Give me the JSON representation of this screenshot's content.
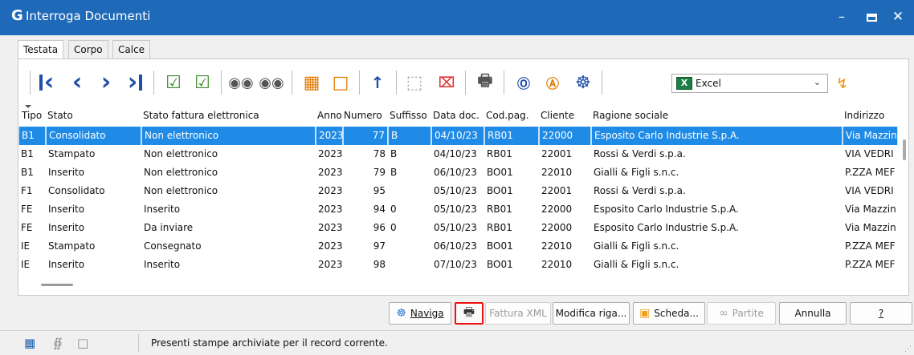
{
  "window": {
    "logo": "G",
    "title": "Interroga Documenti"
  },
  "tabs": [
    "Testata",
    "Corpo",
    "Calce"
  ],
  "toolbar": {
    "export_format": "Excel",
    "icons": [
      "first-icon",
      "prev-icon",
      "next-icon",
      "last-icon",
      "check-icon",
      "check-all-icon",
      "binoculars-icon",
      "binoculars-run-icon",
      "columns-icon",
      "tag-icon",
      "sort-az-icon",
      "select-icon",
      "deselect-icon",
      "print-icon",
      "l-icon",
      "a-icon",
      "ship-wheel-icon",
      "excel-icon",
      "bolt-icon"
    ]
  },
  "grid": {
    "headers": [
      "Tipo",
      "Stato",
      "Stato fattura elettronica",
      "Anno",
      "Numero",
      "Suffisso",
      "Data doc.",
      "Cod.pag.",
      "Cliente",
      "Ragione sociale",
      "Indirizzo"
    ],
    "rows": [
      {
        "tipo": "B1",
        "stato": "Consolidato",
        "fe": "Non elettronico",
        "anno": "2023",
        "numero": "77",
        "suffisso": "B",
        "data": "04/10/23",
        "codpag": "RB01",
        "cliente": "22000",
        "ragione": "Esposito Carlo Industrie S.p.A.",
        "indirizzo": "Via Mazzin"
      },
      {
        "tipo": "B1",
        "stato": "Stampato",
        "fe": "Non elettronico",
        "anno": "2023",
        "numero": "78",
        "suffisso": "B",
        "data": "04/10/23",
        "codpag": "RB01",
        "cliente": "22001",
        "ragione": "Rossi & Verdi s.p.a.",
        "indirizzo": "VIA VEDRI"
      },
      {
        "tipo": "B1",
        "stato": "Inserito",
        "fe": "Non elettronico",
        "anno": "2023",
        "numero": "79",
        "suffisso": "B",
        "data": "06/10/23",
        "codpag": "BO01",
        "cliente": "22010",
        "ragione": "Gialli & Figli s.n.c.",
        "indirizzo": "P.ZZA MEF"
      },
      {
        "tipo": "F1",
        "stato": "Consolidato",
        "fe": "Non elettronico",
        "anno": "2023",
        "numero": "95",
        "suffisso": "",
        "data": "05/10/23",
        "codpag": "BO01",
        "cliente": "22001",
        "ragione": "Rossi & Verdi s.p.a.",
        "indirizzo": "VIA VEDRI"
      },
      {
        "tipo": "FE",
        "stato": "Inserito",
        "fe": "Inserito",
        "anno": "2023",
        "numero": "94",
        "suffisso": "0",
        "data": "05/10/23",
        "codpag": "RB01",
        "cliente": "22000",
        "ragione": "Esposito Carlo Industrie S.p.A.",
        "indirizzo": "Via Mazzin"
      },
      {
        "tipo": "FE",
        "stato": "Inserito",
        "fe": "Da inviare",
        "anno": "2023",
        "numero": "96",
        "suffisso": "0",
        "data": "05/10/23",
        "codpag": "RB01",
        "cliente": "22000",
        "ragione": "Esposito Carlo Industrie S.p.A.",
        "indirizzo": "Via Mazzin"
      },
      {
        "tipo": "IE",
        "stato": "Stampato",
        "fe": "Consegnato",
        "anno": "2023",
        "numero": "97",
        "suffisso": "",
        "data": "06/10/23",
        "codpag": "BO01",
        "cliente": "22010",
        "ragione": "Gialli & Figli s.n.c.",
        "indirizzo": "P.ZZA MEF"
      },
      {
        "tipo": "IE",
        "stato": "Inserito",
        "fe": "Inserito",
        "anno": "2023",
        "numero": "98",
        "suffisso": "",
        "data": "07/10/23",
        "codpag": "BO01",
        "cliente": "22010",
        "ragione": "Gialli & Figli s.n.c.",
        "indirizzo": "P.ZZA MEF"
      }
    ]
  },
  "buttons": {
    "naviga": "Naviga",
    "fattura_xml": "Fattura XML",
    "modifica_riga": "Modifica riga...",
    "scheda": "Scheda...",
    "partite": "Partite",
    "annulla": "Annulla",
    "help": "?"
  },
  "status": {
    "message": "Presenti stampe archiviate per il record corrente."
  }
}
